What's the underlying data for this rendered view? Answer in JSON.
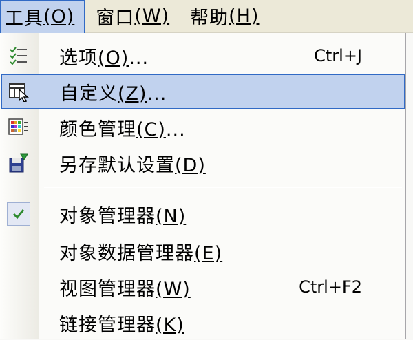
{
  "menubar": {
    "items": [
      {
        "text": "工具",
        "accel": "(O)"
      },
      {
        "text": "窗口",
        "accel": "(W)"
      },
      {
        "text": "帮助",
        "accel": "(H)"
      }
    ]
  },
  "dropdown": {
    "items": [
      {
        "text": "选项",
        "accel": "(O)",
        "suffix": "...",
        "shortcut": "Ctrl+J",
        "icon": "options-list-icon"
      },
      {
        "text": "自定义",
        "accel": "(Z)",
        "suffix": "...",
        "shortcut": "",
        "icon": "customize-icon"
      },
      {
        "text": "颜色管理",
        "accel": "(C)",
        "suffix": "...",
        "shortcut": "",
        "icon": "color-palette-icon"
      },
      {
        "text": "另存默认设置",
        "accel": "(D)",
        "suffix": "",
        "shortcut": "",
        "icon": "save-default-icon"
      },
      {
        "text": "对象管理器",
        "accel": "(N)",
        "suffix": "",
        "shortcut": "",
        "icon": "checkmark-icon",
        "checked": true
      },
      {
        "text": "对象数据管理器",
        "accel": "(E)",
        "suffix": "",
        "shortcut": ""
      },
      {
        "text": "视图管理器",
        "accel": "(W)",
        "suffix": "",
        "shortcut": "Ctrl+F2"
      },
      {
        "text": "链接管理器",
        "accel": "(K)",
        "suffix": "",
        "shortcut": ""
      }
    ]
  },
  "colors": {
    "highlight": "#c1d2ee",
    "highlight_border": "#316ac5",
    "menubar_bg": "#ece9d8"
  }
}
